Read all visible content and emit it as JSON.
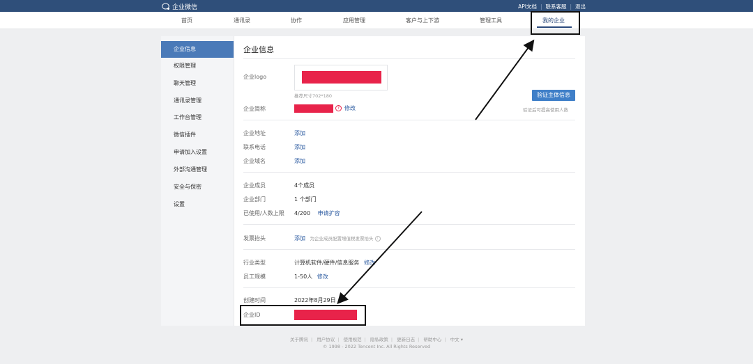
{
  "topbar": {
    "brand": "企业微信",
    "links": [
      "API文档",
      "联系客服",
      "退出"
    ]
  },
  "nav": {
    "items": [
      "首页",
      "通讯录",
      "协作",
      "应用管理",
      "客户与上下游",
      "管理工具",
      "我的企业"
    ],
    "active": "我的企业"
  },
  "sidebar": {
    "items": [
      "企业信息",
      "权限管理",
      "聊天管理",
      "通讯录管理",
      "工作台管理",
      "微信插件",
      "申请加入设置",
      "外部沟通管理",
      "安全与保密",
      "设置"
    ],
    "active": "企业信息"
  },
  "content": {
    "title": "企业信息",
    "logo": {
      "label": "企业logo",
      "hint": "推荐尺寸702*180"
    },
    "verify": {
      "button": "验证主体信息",
      "hint": "验证后可提高使用人数"
    },
    "short_name": {
      "label": "企业简称",
      "edit": "修改"
    },
    "address": {
      "label": "企业地址",
      "action": "添加"
    },
    "phone": {
      "label": "联系电话",
      "action": "添加"
    },
    "domain": {
      "label": "企业域名",
      "action": "添加"
    },
    "members": {
      "label": "企业成员",
      "value": "4个成员"
    },
    "departments": {
      "label": "企业部门",
      "value": "1 个部门"
    },
    "capacity": {
      "label": "已使用/人数上限",
      "value": "4/200",
      "action": "申请扩容"
    },
    "invoice": {
      "label": "发票抬头",
      "action": "添加",
      "hint": "为企业成员配置增值税发票抬头"
    },
    "industry": {
      "label": "行业类型",
      "value": "计算机软件/硬件/信息服务",
      "edit": "修改"
    },
    "scale": {
      "label": "员工规模",
      "value": "1-50人",
      "edit": "修改"
    },
    "created": {
      "label": "创建时间",
      "value": "2022年8月29日"
    },
    "corp_id": {
      "label": "企业ID"
    }
  },
  "footer": {
    "links": [
      "关于腾讯",
      "用户协议",
      "使用规范",
      "隐私政策",
      "更新日志",
      "帮助中心",
      "中文 ▾"
    ],
    "copyright": "© 1998 - 2022 Tencent Inc. All Rights Reserved"
  },
  "colors": {
    "topbar": "#2f4f7a",
    "accent": "#4a7ab8",
    "link": "#2b5aa0",
    "redaction": "#e8234a"
  }
}
